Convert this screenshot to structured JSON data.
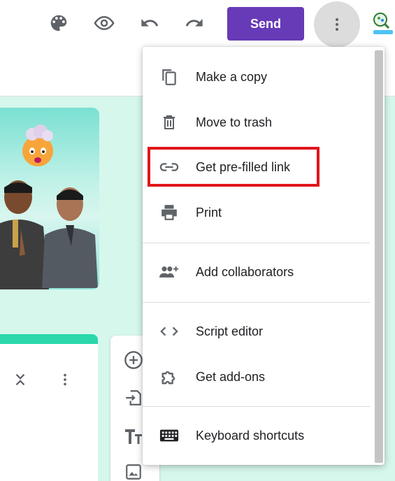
{
  "toolbar": {
    "send_label": "Send",
    "icons": [
      "palette-icon",
      "eye-icon",
      "undo-icon",
      "redo-icon",
      "more-vert-icon"
    ]
  },
  "menu": {
    "items": [
      {
        "label": "Make a copy",
        "icon": "copy-icon"
      },
      {
        "label": "Move to trash",
        "icon": "trash-icon"
      },
      {
        "label": "Get pre-filled link",
        "icon": "link-icon"
      },
      {
        "label": "Print",
        "icon": "print-icon"
      },
      {
        "label": "Add collaborators",
        "icon": "add-people-icon"
      },
      {
        "label": "Script editor",
        "icon": "code-icon"
      },
      {
        "label": "Get add-ons",
        "icon": "puzzle-icon"
      },
      {
        "label": "Keyboard shortcuts",
        "icon": "keyboard-icon"
      }
    ],
    "highlighted_item": "Get pre-filled link",
    "highlight_color": "#e0161b"
  },
  "colors": {
    "send_button": "#673ab7",
    "canvas": "#d6f7ec",
    "accent": "#2ad8ac"
  },
  "side_tools": [
    "add-question-icon",
    "import-questions-icon",
    "add-title-icon",
    "add-image-icon"
  ]
}
